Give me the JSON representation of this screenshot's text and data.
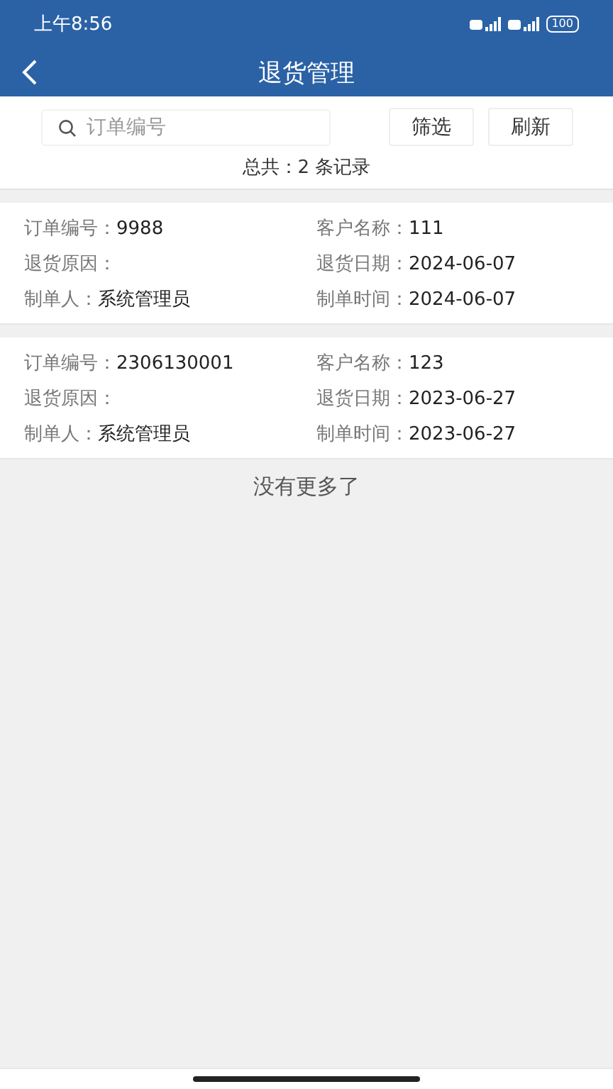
{
  "status_bar": {
    "time": "上午8:56",
    "battery": "100"
  },
  "nav": {
    "title": "退货管理"
  },
  "search": {
    "placeholder": "订单编号"
  },
  "buttons": [
    "筛选",
    "刷新"
  ],
  "total": "总共：2 条记录",
  "records": [
    {
      "fields": [
        {
          "label": "订单编号：",
          "value": "9988"
        },
        {
          "label": "客户名称：",
          "value": "111"
        },
        {
          "label": "退货原因："
        },
        {
          "label": "退货日期：",
          "value": "2024-06-07"
        },
        {
          "label": "制单人：",
          "value": "系统管理员"
        },
        {
          "label": "制单时间：",
          "value": "2024-06-07"
        }
      ]
    },
    {
      "fields": [
        {
          "label": "订单编号：",
          "value": "2306130001"
        },
        {
          "label": "客户名称：",
          "value": "123"
        },
        {
          "label": "退货原因："
        },
        {
          "label": "退货日期：",
          "value": "2023-06-27"
        },
        {
          "label": "制单人：",
          "value": "系统管理员"
        },
        {
          "label": "制单时间：",
          "value": "2023-06-27"
        }
      ]
    }
  ],
  "footer": "没有更多了"
}
